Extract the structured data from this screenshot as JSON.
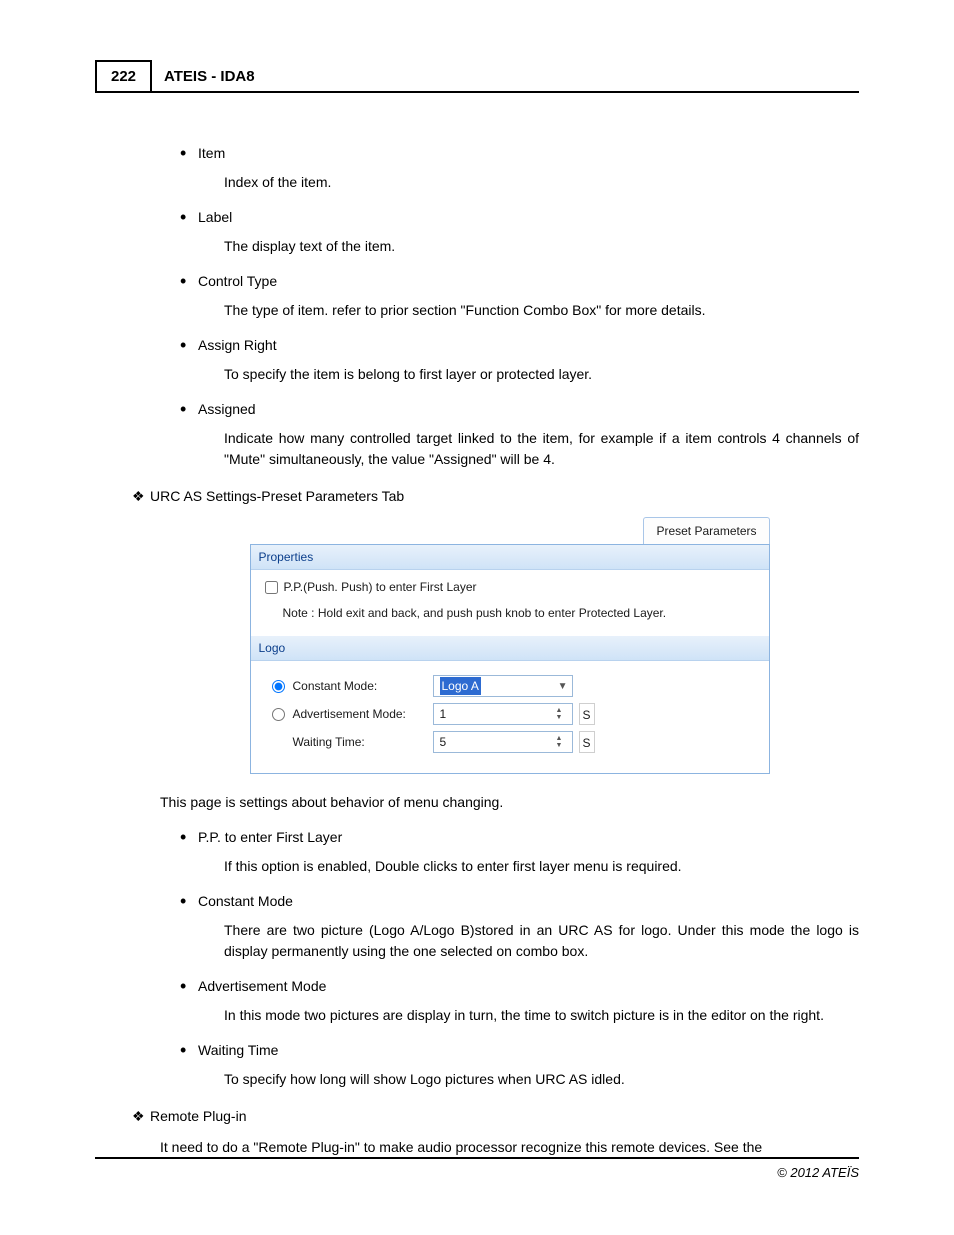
{
  "header": {
    "page_number": "222",
    "title": "ATEIS - IDA8"
  },
  "defs_top": [
    {
      "term": "Item",
      "def": "Index of the item."
    },
    {
      "term": "Label",
      "def": "The display text of the item."
    },
    {
      "term": "Control Type",
      "def": "The type of item. refer to prior section \"Function Combo Box\" for more details."
    },
    {
      "term": "Assign Right",
      "def": "To specify the item is belong to first layer or protected layer."
    },
    {
      "term": "Assigned",
      "def": "Indicate how many controlled target linked to the item, for example if a item controls 4 channels of \"Mute\" simultaneously, the value \"Assigned\" will be 4."
    }
  ],
  "section1": {
    "title": "URC AS Settings-Preset Parameters Tab"
  },
  "shot": {
    "tab_label": "Preset Parameters",
    "properties_header": "Properties",
    "pp_label": "P.P.(Push. Push) to enter First Layer",
    "pp_checked": false,
    "note": "Note : Hold exit and back, and push push knob to enter Protected Layer.",
    "logo_header": "Logo",
    "constant_label": "Constant Mode:",
    "constant_selected": true,
    "constant_value": "Logo A",
    "adv_label": "Advertisement Mode:",
    "adv_selected": false,
    "adv_value": "1",
    "adv_unit": "S",
    "wait_label": "Waiting Time:",
    "wait_value": "5",
    "wait_unit": "S"
  },
  "intro_after_shot": "This page is settings about behavior of menu changing.",
  "defs_bottom": [
    {
      "term": "P.P. to enter First Layer",
      "def": "If this option is enabled, Double clicks to enter first layer menu is required."
    },
    {
      "term": "Constant Mode",
      "def": "There are two picture (Logo A/Logo B)stored in an URC AS for logo. Under this mode the logo is display permanently using the one selected on combo box."
    },
    {
      "term": "Advertisement Mode",
      "def": "In this mode two pictures are display in turn, the time to switch picture is in the editor on the right."
    },
    {
      "term": "Waiting Time",
      "def": "To specify how long will show Logo pictures when URC AS idled."
    }
  ],
  "section2": {
    "title": "Remote Plug-in",
    "body": "It need to do a \"Remote Plug-in\" to make audio processor recognize this remote devices. See the"
  },
  "footer": "© 2012 ATEÏS"
}
